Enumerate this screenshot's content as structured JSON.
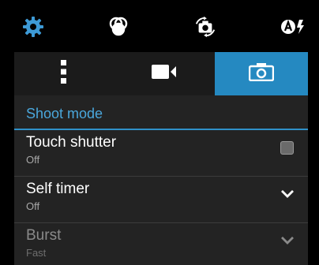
{
  "topbar": {
    "icons": [
      "gear-icon",
      "color-effects-icon",
      "switch-camera-icon",
      "auto-flash-icon"
    ]
  },
  "tabs": [
    {
      "name": "more-options-tab",
      "icon": "vertical-dots-icon",
      "active": false
    },
    {
      "name": "video-settings-tab",
      "icon": "video-camera-icon",
      "active": false
    },
    {
      "name": "camera-settings-tab",
      "icon": "camera-icon",
      "active": true
    }
  ],
  "section": {
    "title": "Shoot mode"
  },
  "settings": [
    {
      "title": "Touch shutter",
      "value": "Off",
      "control": "checkbox",
      "checked": false
    },
    {
      "title": "Self timer",
      "value": "Off",
      "control": "dropdown"
    },
    {
      "title": "Burst",
      "value": "Fast",
      "control": "dropdown",
      "disabled": true
    }
  ],
  "colors": {
    "accent": "#2589c1",
    "header_text": "#4aa7dc",
    "panel_bg": "#232323"
  }
}
